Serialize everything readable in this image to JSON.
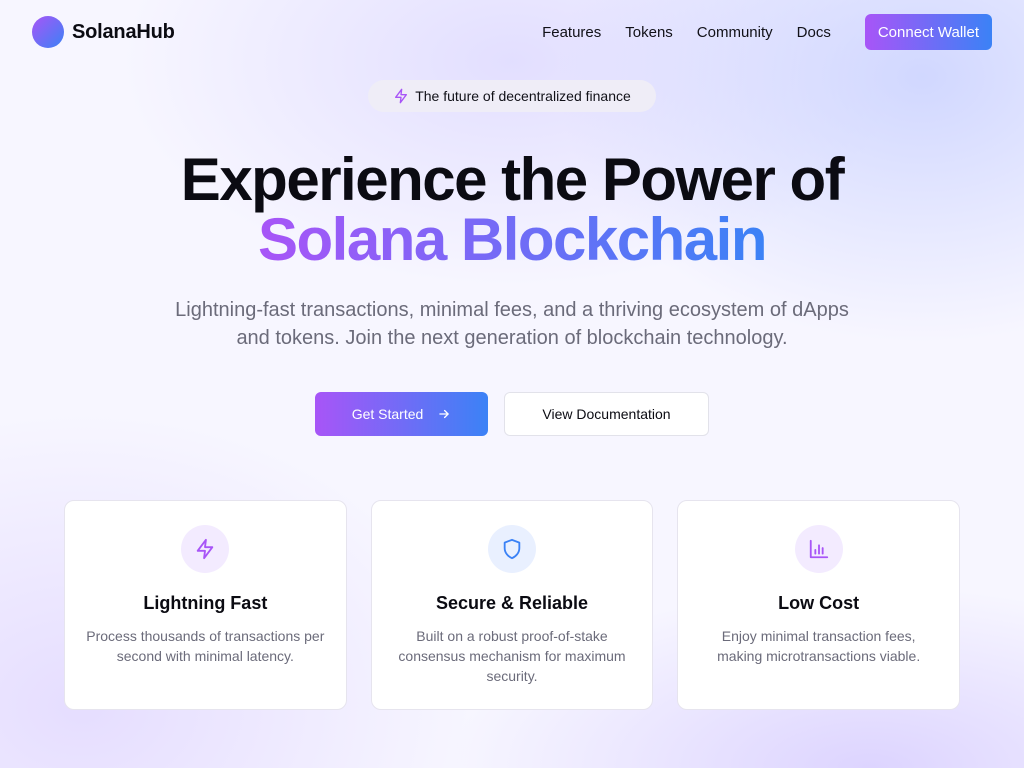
{
  "brand": {
    "name": "SolanaHub"
  },
  "nav": {
    "items": [
      {
        "label": "Features"
      },
      {
        "label": "Tokens"
      },
      {
        "label": "Community"
      },
      {
        "label": "Docs"
      }
    ],
    "connect_label": "Connect Wallet"
  },
  "hero": {
    "pill_text": "The future of decentralized finance",
    "pill_icon": "lightning-icon",
    "title_line1": "Experience the Power of",
    "title_line2": "Solana Blockchain",
    "subtitle": "Lightning-fast transactions, minimal fees, and a thriving ecosystem of dApps and tokens. Join the next generation of blockchain technology.",
    "primary_cta": "Get Started",
    "secondary_cta": "View Documentation"
  },
  "features": [
    {
      "icon": "lightning-icon",
      "title": "Lightning Fast",
      "description": "Process thousands of transactions per second with minimal latency."
    },
    {
      "icon": "shield-icon",
      "title": "Secure & Reliable",
      "description": "Built on a robust proof-of-stake consensus mechanism for maximum security."
    },
    {
      "icon": "bar-chart-icon",
      "title": "Low Cost",
      "description": "Enjoy minimal transaction fees, making microtransactions viable."
    }
  ],
  "colors": {
    "gradient_start": "#a855f7",
    "gradient_end": "#3b82f6",
    "text_dark": "#0b0b12",
    "text_muted": "#6b6b7a"
  }
}
